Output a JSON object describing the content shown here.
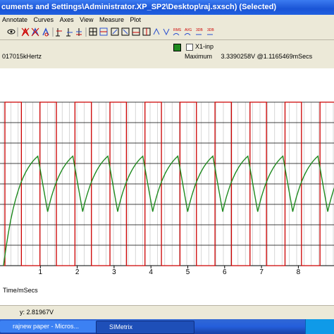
{
  "window": {
    "title": "cuments and Settings\\Administrator.XP_SP2\\Desktop\\raj.sxsch) (Selected)"
  },
  "menu": [
    "Annotate",
    "Curves",
    "Axes",
    "View",
    "Measure",
    "Plot"
  ],
  "toolbar_icons": [
    "eye-icon",
    "curve-delete-icon",
    "curve-delete-icon",
    "curve-cut-icon",
    "cursor-icon",
    "cursor-icon",
    "cursor-icon",
    "grid-icon",
    "grid-icon",
    "zoom-icon",
    "zoom-icon",
    "zoom-icon",
    "zoom-icon",
    "measure-icon",
    "measure-icon",
    "rms-icon",
    "avg-icon",
    "3db-icon",
    "3db-icon"
  ],
  "toolbar_text": {
    "rms": "RMS",
    "avg": "AVG",
    "db3a": "3DB",
    "db3b": "3DB"
  },
  "info": {
    "frequency": "017015kHertz",
    "legend_label": "X1-inp",
    "maximum_label": "Maximum",
    "maximum_value": "3.3390258V @1.1165469mSecs"
  },
  "colors": {
    "trace_square": "#cc0000",
    "trace_ramp": "#1f8a1f",
    "legend_swatch": "#1f8a1f",
    "grid": "#000000"
  },
  "chart_data": {
    "type": "line",
    "xlabel": "Time/mSecs",
    "tick_labels": [
      "1",
      "2",
      "3",
      "4",
      "5",
      "6",
      "7",
      "8"
    ],
    "series": [
      {
        "type": "square",
        "period": 0.95,
        "duty": 0.47,
        "low": 0,
        "high": 1
      },
      {
        "type": "rc_ramp",
        "rise_fraction": 0.72,
        "initial_peak": 0.67,
        "trough": 0.33
      }
    ]
  },
  "status": {
    "y_readout": "y: 2.81967V"
  },
  "taskbar": {
    "item1": "rajnew paper - Micros...",
    "item2": "SIMetrix"
  }
}
